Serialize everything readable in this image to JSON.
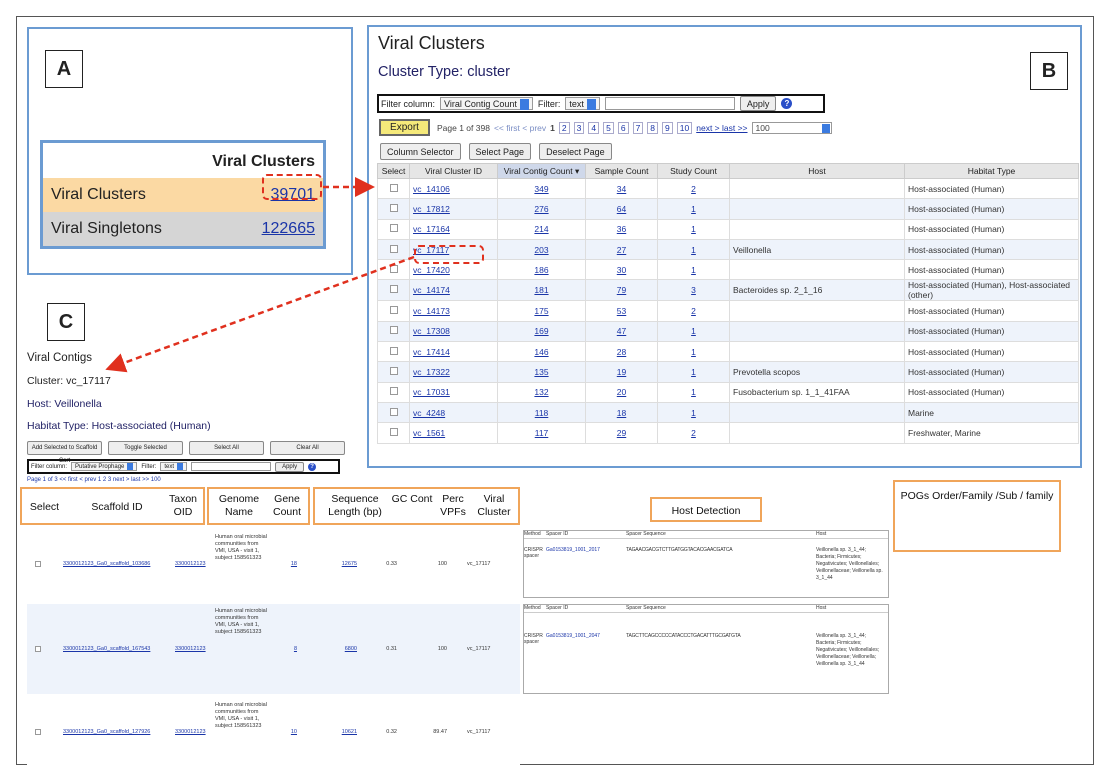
{
  "panels": {
    "a": "A",
    "b": "B",
    "c": "C"
  },
  "panel_a": {
    "header": "Viral Clusters",
    "rows": [
      {
        "label": "Viral Clusters",
        "value": "39701"
      },
      {
        "label": "Viral Singletons",
        "value": "122665"
      }
    ]
  },
  "panel_b": {
    "title": "Viral Clusters",
    "subtitle": "Cluster Type: cluster",
    "filter_column_label": "Filter column:",
    "filter_column_value": "Viral Contig Count",
    "filter_label": "Filter:",
    "filter_value": "text",
    "apply": "Apply",
    "export": "Export",
    "page_info": "Page 1 of 398",
    "first_prev": "<< first  < prev",
    "pages": [
      "1",
      "2",
      "3",
      "4",
      "5",
      "6",
      "7",
      "8",
      "9",
      "10"
    ],
    "next_last": "next >  last >>",
    "page_size": "100",
    "column_selector": "Column Selector",
    "select_page": "Select Page",
    "deselect_page": "Deselect Page",
    "columns": [
      "Select",
      "Viral Cluster ID",
      "Viral Contig Count ▾",
      "Sample Count",
      "Study Count",
      "Host",
      "Habitat Type"
    ],
    "rows": [
      {
        "id": "vc_14106",
        "contigs": "349",
        "samples": "34",
        "studies": "2",
        "host": "",
        "habitat": "Host-associated (Human)"
      },
      {
        "id": "vc_17812",
        "contigs": "276",
        "samples": "64",
        "studies": "1",
        "host": "",
        "habitat": "Host-associated (Human)"
      },
      {
        "id": "vc_17164",
        "contigs": "214",
        "samples": "36",
        "studies": "1",
        "host": "",
        "habitat": "Host-associated (Human)"
      },
      {
        "id": "vc_17117",
        "contigs": "203",
        "samples": "27",
        "studies": "1",
        "host": "Veillonella",
        "habitat": "Host-associated (Human)"
      },
      {
        "id": "vc_17420",
        "contigs": "186",
        "samples": "30",
        "studies": "1",
        "host": "",
        "habitat": "Host-associated (Human)"
      },
      {
        "id": "vc_14174",
        "contigs": "181",
        "samples": "79",
        "studies": "3",
        "host": "Bacteroides sp. 2_1_16",
        "habitat": "Host-associated (Human), Host-associated (other)"
      },
      {
        "id": "vc_14173",
        "contigs": "175",
        "samples": "53",
        "studies": "2",
        "host": "",
        "habitat": "Host-associated (Human)"
      },
      {
        "id": "vc_17308",
        "contigs": "169",
        "samples": "47",
        "studies": "1",
        "host": "",
        "habitat": "Host-associated (Human)"
      },
      {
        "id": "vc_17414",
        "contigs": "146",
        "samples": "28",
        "studies": "1",
        "host": "",
        "habitat": "Host-associated (Human)"
      },
      {
        "id": "vc_17322",
        "contigs": "135",
        "samples": "19",
        "studies": "1",
        "host": "Prevotella scopos",
        "habitat": "Host-associated (Human)"
      },
      {
        "id": "vc_17031",
        "contigs": "132",
        "samples": "20",
        "studies": "1",
        "host": "Fusobacterium sp. 1_1_41FAA",
        "habitat": "Host-associated (Human)"
      },
      {
        "id": "vc_4248",
        "contigs": "118",
        "samples": "18",
        "studies": "1",
        "host": "",
        "habitat": "Marine"
      },
      {
        "id": "vc_1561",
        "contigs": "117",
        "samples": "29",
        "studies": "2",
        "host": "",
        "habitat": "Freshwater, Marine"
      }
    ]
  },
  "panel_c": {
    "title": "Viral Contigs",
    "cluster": "Cluster: vc_17117",
    "host": "Host: Veillonella",
    "habitat": "Habitat Type: Host-associated (Human)",
    "buttons": [
      "Add Selected to Scaffold Cart",
      "Toggle Selected",
      "Select All",
      "Clear All"
    ],
    "filter_column_label": "Filter column:",
    "filter_column_value": "Putative Prophage",
    "filter_label": "Filter:",
    "filter_value": "text",
    "apply": "Apply",
    "pager": "Page 1 of 3   << first  < prev   1  2  3   next >  last >>   100",
    "headers": {
      "select": "Select",
      "scaffold": "Scaffold ID",
      "taxon": "Taxon OID",
      "genome": "Genome Name",
      "gene": "Gene Count",
      "seqlen": "Sequence Length (bp)",
      "gc": "GC Cont",
      "vpfs": "Perc VPFs",
      "cluster": "Viral Cluster",
      "host_detection": "Host Detection",
      "pogs": "POGs Order/Family /Sub  / family"
    },
    "rows": [
      {
        "scaffold": "3300012123_Ga0_scaffold_103686",
        "taxon": "3300012123",
        "genome": "Human oral microbial communities from VMI, USA - visit 1, subject 158561323",
        "gene": "18",
        "length": "12675",
        "gc": "0.33",
        "vpfs": "100",
        "cluster": "vc_17117"
      },
      {
        "scaffold": "3300012123_Ga0_scaffold_167543",
        "taxon": "3300012123",
        "genome": "Human oral microbial communities from VMI, USA - visit 1, subject 158561323",
        "gene": "8",
        "length": "6800",
        "gc": "0.31",
        "vpfs": "100",
        "cluster": "vc_17117"
      },
      {
        "scaffold": "3300012123_Ga0_scaffold_127926",
        "taxon": "3300012123",
        "genome": "Human oral microbial communities from VMI, USA - visit 1, subject 158561323",
        "gene": "10",
        "length": "10621",
        "gc": "0.32",
        "vpfs": "89.47",
        "cluster": "vc_17117"
      }
    ],
    "host_table": {
      "headers": [
        "Method",
        "Spacer ID",
        "Spacer Sequence",
        "Host"
      ],
      "method": "CRISPR spacer",
      "block1_spacer": "Ga0153819_1001_2017",
      "block1_sequence": "TAGAACGACGTCTTGATGGTACACGAACGATCA",
      "block1_host": "Veillonella sp. 3_1_44; Bacteria; Firmicutes; Negativicutes; Veillonellales; Veillonellaceae; Veillonella sp. 3_1_44",
      "block2_spacer": "Ga0153819_1001_2047",
      "block2_sequence": "TAGCTTCAGCCCCCATACCCTGACATTTGCGATGTA",
      "block2_host": "Veillonella sp. 3_1_44; Bacteria; Firmicutes; Negativicutes; Veillonellales; Veillonellaceae; Veillonella; Veillonella sp. 3_1_44"
    }
  },
  "colors": {
    "accent_blue": "#6b9bd2",
    "highlight_orange": "#f0a55a",
    "dashed_red": "#e0301e",
    "link_blue": "#1a35a8"
  }
}
